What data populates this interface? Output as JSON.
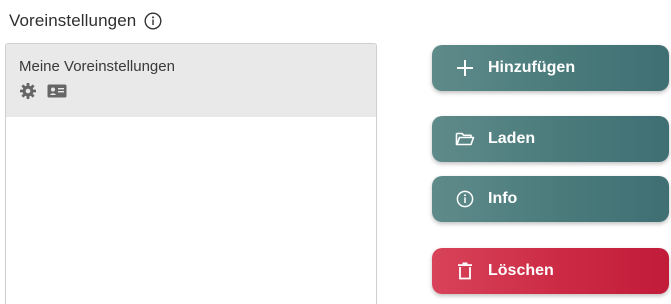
{
  "header": {
    "title": "Voreinstellungen",
    "info_icon": "info-circle-icon"
  },
  "presets": {
    "items": [
      {
        "label": "Meine Voreinstellungen",
        "icons": [
          "gear-icon",
          "id-card-icon"
        ],
        "selected": true
      }
    ]
  },
  "actions": {
    "add_label": "Hinzufügen",
    "load_label": "Laden",
    "info_label": "Info",
    "delete_label": "Löschen"
  },
  "colors": {
    "primary_button": "#4a7b7b",
    "danger_button": "#cc2a44",
    "selected_row": "#e9e9e9"
  }
}
